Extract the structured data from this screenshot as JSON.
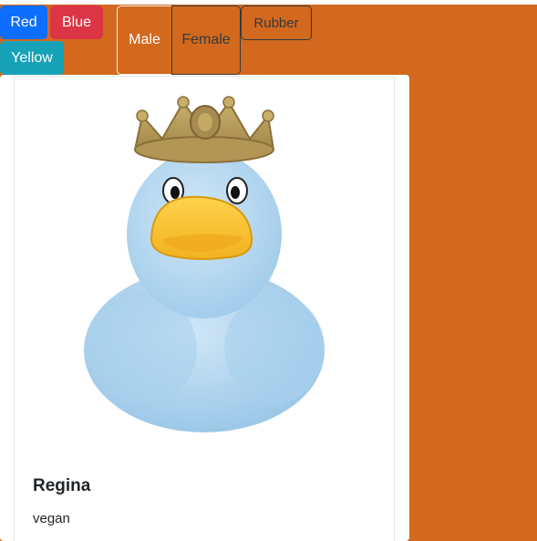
{
  "filters": {
    "colors": [
      "Red",
      "Blue",
      "Yellow"
    ],
    "genders": [
      "Male",
      "Female"
    ],
    "material": "Rubber"
  },
  "colors": {
    "background": "#d2691e",
    "red_button": "#0d6efd",
    "blue_button": "#dc3545",
    "yellow_button": "#17a2b8"
  },
  "product": {
    "name": "Regina",
    "description": "vegan",
    "image_icon": "light-blue-rubber-duck-with-gold-crown"
  }
}
